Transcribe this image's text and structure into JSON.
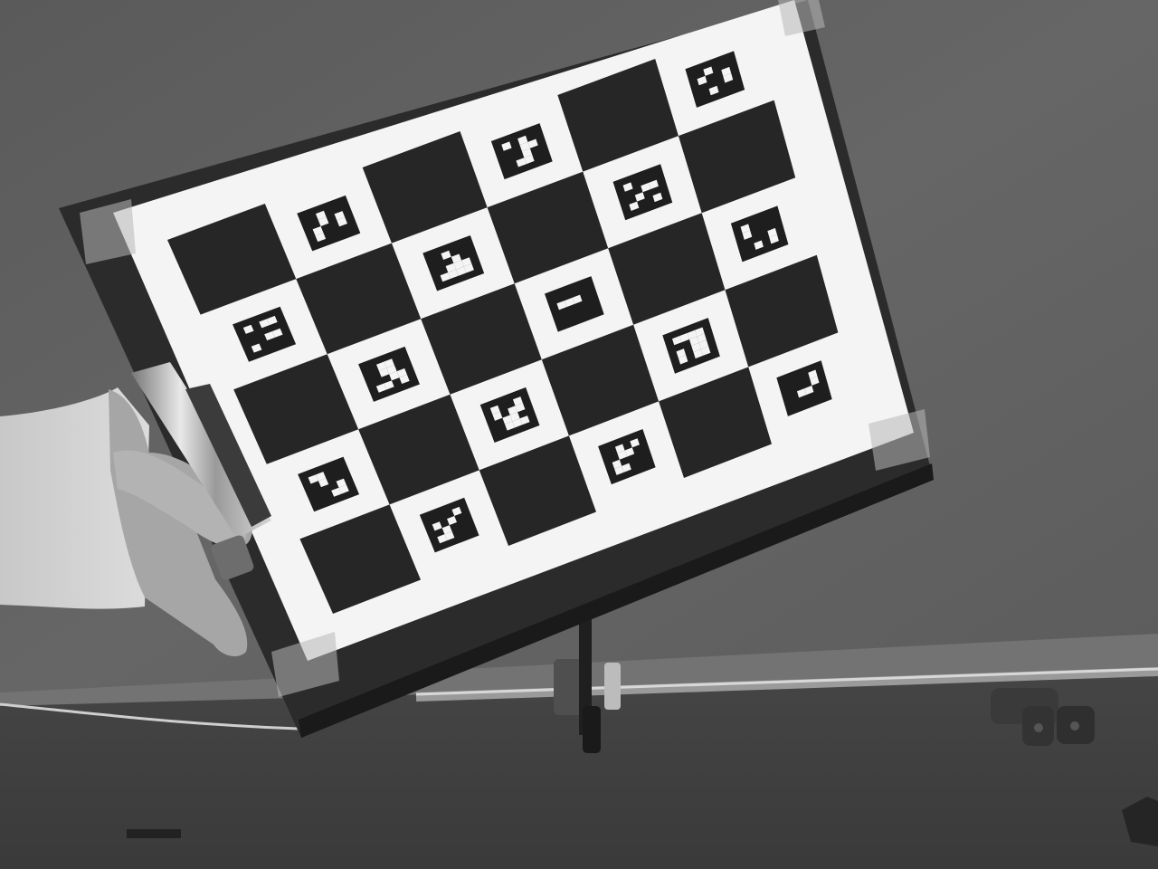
{
  "scene": {
    "image_kind": "grayscale photo",
    "board": {
      "rows": 5,
      "cols": 6,
      "paper_color": "#f4f4f4",
      "square_color": "#262626",
      "marker_color": "#1e1e1e"
    },
    "colors": {
      "wall": "#626262",
      "floor": "#3e3e3e",
      "baseboard": "#767676",
      "clipboard": "#2c2c2c",
      "skin": "#a4a4a4",
      "sleeve": "#d2d2d2",
      "clip_metal": "#bdbdbd"
    },
    "icons": [
      "hand",
      "clipboard-clip",
      "tripod-stand",
      "barbell",
      "dumbbell"
    ]
  }
}
